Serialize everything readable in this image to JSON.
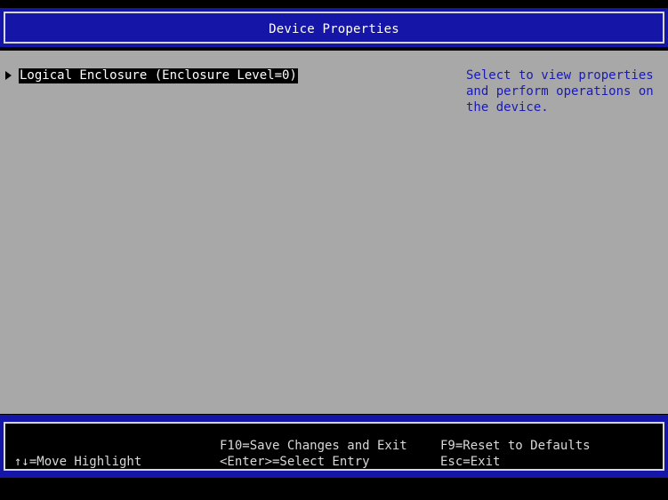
{
  "header": {
    "title": "Device Properties"
  },
  "menu": {
    "items": [
      {
        "label": "Logical Enclosure (Enclosure Level=0)",
        "selected": true
      }
    ]
  },
  "help": {
    "lines": [
      "Select to view properties",
      "and perform operations on",
      "the device."
    ]
  },
  "footer": {
    "move_highlight": "↑↓=Move Highlight",
    "save_exit": "F10=Save Changes and Exit",
    "select_entry": "<Enter>=Select Entry",
    "reset_defaults": "F9=Reset to Defaults",
    "exit": "Esc=Exit"
  },
  "colors": {
    "title_bar": "#1515a8",
    "content_bg": "#a8a8a8",
    "help_text": "#1a1ab0",
    "highlight_bg": "#000000",
    "footer_bg": "#000000"
  }
}
